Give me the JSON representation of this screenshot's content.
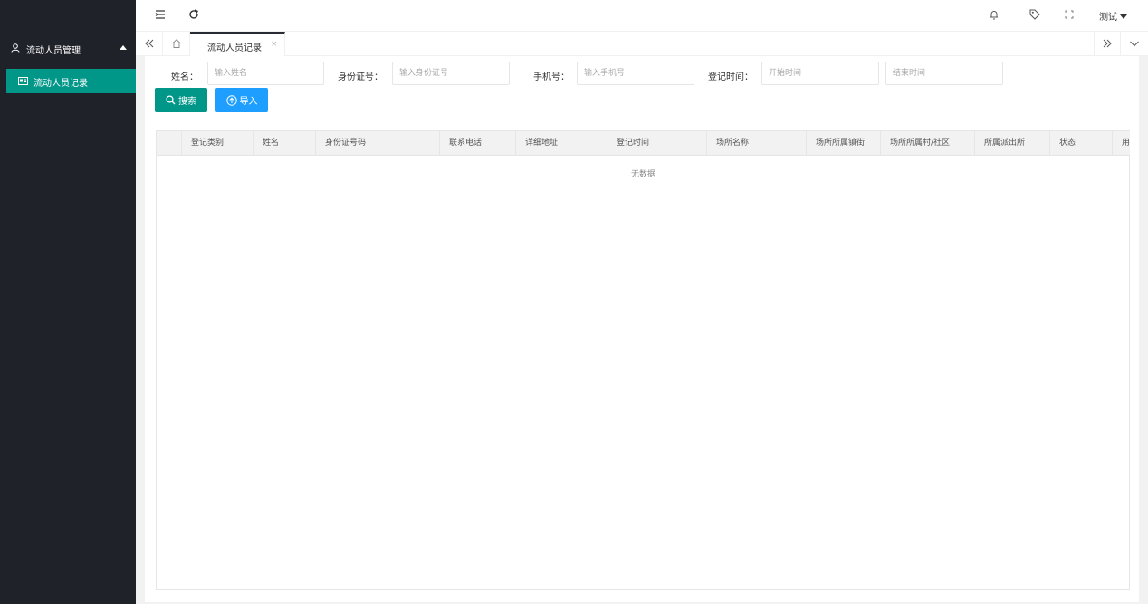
{
  "sidebar": {
    "group_label": "流动人员管理",
    "group_icon": "user-icon",
    "item_label": "流动人员记录",
    "item_icon": "id-card-icon",
    "accent": "#009688"
  },
  "topbar": {
    "user_name": "测试"
  },
  "tabs": {
    "active_label": "流动人员记录",
    "close_glyph": "×"
  },
  "filters": {
    "name_label": "姓名：",
    "name_placeholder": "输入姓名",
    "id_label": "身份证号：",
    "id_placeholder": "输入身份证号",
    "phone_label": "手机号：",
    "phone_placeholder": "输入手机号",
    "time_label": "登记时间：",
    "start_placeholder": "开始时间",
    "end_placeholder": "结束时间"
  },
  "buttons": {
    "search": "搜索",
    "import": "导入"
  },
  "table": {
    "columns": [
      "登记类别",
      "姓名",
      "身份证号码",
      "联系电话",
      "详细地址",
      "登记时间",
      "场所名称",
      "场所所属镇街",
      "场所所属村/社区",
      "所属派出所",
      "状态",
      "用"
    ],
    "empty_text": "无数据"
  }
}
